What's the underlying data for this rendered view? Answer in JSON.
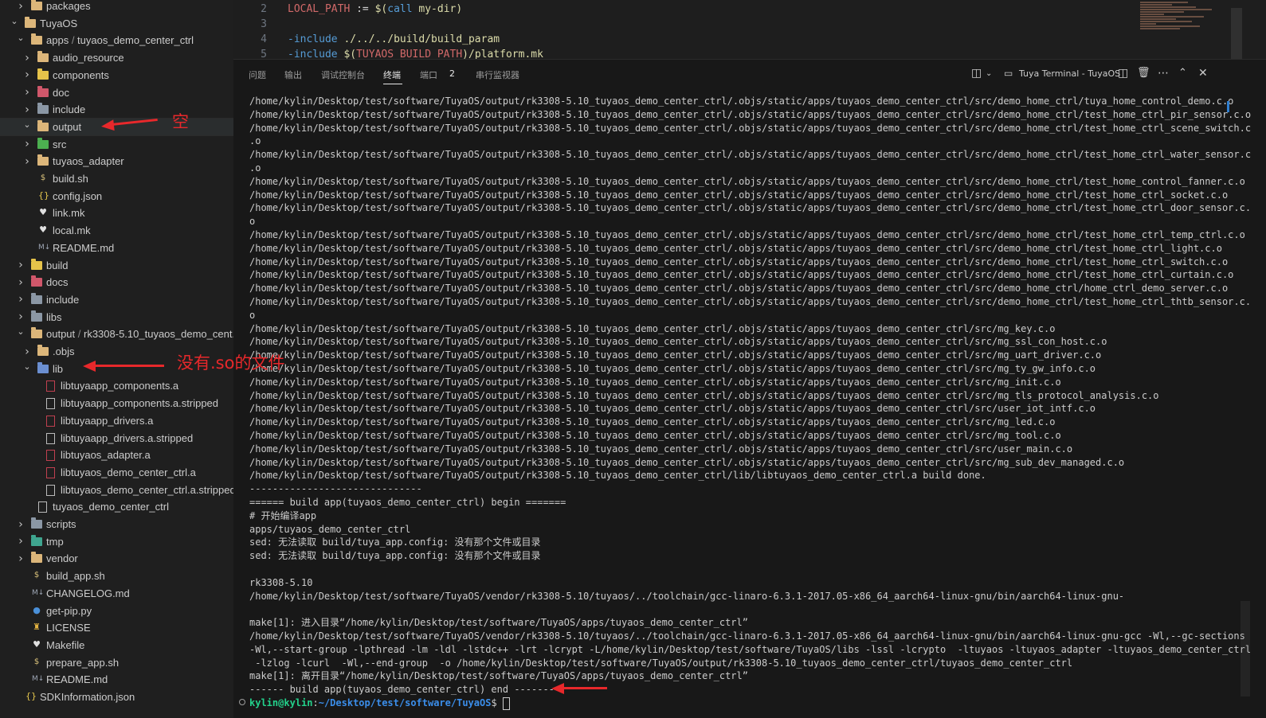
{
  "explorer": {
    "items": [
      {
        "label": "packages",
        "depth": 1,
        "expanded": false,
        "kind": "folder"
      },
      {
        "label": "TuyaOS",
        "depth": 0,
        "expanded": true,
        "kind": "folder"
      },
      {
        "label_a": "apps",
        "label_sep": " / ",
        "label_b": "tuyaos_demo_center_ctrl",
        "depth": 1,
        "expanded": true,
        "kind": "folder"
      },
      {
        "label": "audio_resource",
        "depth": 2,
        "expanded": false,
        "kind": "folder"
      },
      {
        "label": "components",
        "depth": 2,
        "expanded": false,
        "kind": "folder-build"
      },
      {
        "label": "doc",
        "depth": 2,
        "expanded": false,
        "kind": "folder-doc"
      },
      {
        "label": "include",
        "depth": 2,
        "expanded": false,
        "kind": "folder-grey"
      },
      {
        "label": "output",
        "depth": 2,
        "expanded": true,
        "kind": "folder",
        "selected": true
      },
      {
        "label": "src",
        "depth": 2,
        "expanded": false,
        "kind": "folder-src"
      },
      {
        "label": "tuyaos_adapter",
        "depth": 2,
        "expanded": false,
        "kind": "folder"
      },
      {
        "label": "build.sh",
        "depth": 2,
        "kind": "shell"
      },
      {
        "label": "config.json",
        "depth": 2,
        "kind": "json"
      },
      {
        "label": "link.mk",
        "depth": 2,
        "kind": "heart"
      },
      {
        "label": "local.mk",
        "depth": 2,
        "kind": "heart"
      },
      {
        "label": "README.md",
        "depth": 2,
        "kind": "md"
      },
      {
        "label": "build",
        "depth": 1,
        "expanded": false,
        "kind": "folder-build"
      },
      {
        "label": "docs",
        "depth": 1,
        "expanded": false,
        "kind": "folder-doc"
      },
      {
        "label": "include",
        "depth": 1,
        "expanded": false,
        "kind": "folder-grey"
      },
      {
        "label": "libs",
        "depth": 1,
        "expanded": false,
        "kind": "folder-grey"
      },
      {
        "label_a": "output",
        "label_sep": " / ",
        "label_b": "rk3308-5.10_tuyaos_demo_cent...",
        "depth": 1,
        "expanded": true,
        "kind": "folder"
      },
      {
        "label": ".objs",
        "depth": 2,
        "expanded": false,
        "kind": "folder"
      },
      {
        "label": "lib",
        "depth": 2,
        "expanded": true,
        "kind": "folder-blue"
      },
      {
        "label": "libtuyaapp_components.a",
        "depth": 3,
        "kind": "arch"
      },
      {
        "label": "libtuyaapp_components.a.stripped",
        "depth": 3,
        "kind": "doc"
      },
      {
        "label": "libtuyaapp_drivers.a",
        "depth": 3,
        "kind": "arch"
      },
      {
        "label": "libtuyaapp_drivers.a.stripped",
        "depth": 3,
        "kind": "doc"
      },
      {
        "label": "libtuyaos_adapter.a",
        "depth": 3,
        "kind": "arch"
      },
      {
        "label": "libtuyaos_demo_center_ctrl.a",
        "depth": 3,
        "kind": "arch"
      },
      {
        "label": "libtuyaos_demo_center_ctrl.a.stripped",
        "depth": 3,
        "kind": "doc"
      },
      {
        "label": "tuyaos_demo_center_ctrl",
        "depth": 2,
        "kind": "doc"
      },
      {
        "label": "scripts",
        "depth": 1,
        "expanded": false,
        "kind": "folder-grey"
      },
      {
        "label": "tmp",
        "depth": 1,
        "expanded": false,
        "kind": "folder-tmp"
      },
      {
        "label": "vendor",
        "depth": 1,
        "expanded": false,
        "kind": "folder"
      },
      {
        "label": "build_app.sh",
        "depth": 1,
        "kind": "shell"
      },
      {
        "label": "CHANGELOG.md",
        "depth": 1,
        "kind": "md"
      },
      {
        "label": "get-pip.py",
        "depth": 1,
        "kind": "py"
      },
      {
        "label": "LICENSE",
        "depth": 1,
        "kind": "lic"
      },
      {
        "label": "Makefile",
        "depth": 1,
        "kind": "heart"
      },
      {
        "label": "prepare_app.sh",
        "depth": 1,
        "kind": "shell"
      },
      {
        "label": "README.md",
        "depth": 1,
        "kind": "md"
      },
      {
        "label": "SDKInformation.json",
        "depth": 0,
        "kind": "json"
      }
    ]
  },
  "editor": {
    "lines": [
      {
        "num": "2",
        "parts": [
          {
            "t": "LOCAL_PATH",
            "c": "var"
          },
          {
            "t": " := ",
            "c": "op"
          },
          {
            "t": "$(",
            "c": "fn"
          },
          {
            "t": "call",
            "c": "kw"
          },
          {
            "t": " my-dir",
            "c": "fn"
          },
          {
            "t": ")",
            "c": "fn"
          }
        ]
      },
      {
        "num": "3",
        "parts": []
      },
      {
        "num": "4",
        "parts": [
          {
            "t": "-include",
            "c": "kw"
          },
          {
            "t": " ./../../build/build_param",
            "c": "fn"
          }
        ]
      },
      {
        "num": "5",
        "parts": [
          {
            "t": "-include",
            "c": "kw"
          },
          {
            "t": " $(",
            "c": "fn"
          },
          {
            "t": "TUYAOS_BUILD_PATH",
            "c": "var"
          },
          {
            "t": ")/platform.mk",
            "c": "fn"
          }
        ]
      }
    ]
  },
  "panel": {
    "tabs": [
      {
        "label": "问题",
        "active": false
      },
      {
        "label": "输出",
        "active": false
      },
      {
        "label": "调试控制台",
        "active": false
      },
      {
        "label": "终端",
        "active": true
      },
      {
        "label": "端口",
        "active": false,
        "badge": "2"
      },
      {
        "label": "串行监视器",
        "active": false
      }
    ],
    "terminal_name": "Tuya Terminal - TuyaOS"
  },
  "terminal": {
    "lines": [
      "/home/kylin/Desktop/test/software/TuyaOS/output/rk3308-5.10_tuyaos_demo_center_ctrl/.objs/static/apps/tuyaos_demo_center_ctrl/src/demo_home_ctrl/tuya_home_control_demo.c.o",
      "/home/kylin/Desktop/test/software/TuyaOS/output/rk3308-5.10_tuyaos_demo_center_ctrl/.objs/static/apps/tuyaos_demo_center_ctrl/src/demo_home_ctrl/test_home_ctrl_pir_sensor.c.o",
      "/home/kylin/Desktop/test/software/TuyaOS/output/rk3308-5.10_tuyaos_demo_center_ctrl/.objs/static/apps/tuyaos_demo_center_ctrl/src/demo_home_ctrl/test_home_ctrl_scene_switch.c",
      ".o",
      "/home/kylin/Desktop/test/software/TuyaOS/output/rk3308-5.10_tuyaos_demo_center_ctrl/.objs/static/apps/tuyaos_demo_center_ctrl/src/demo_home_ctrl/test_home_ctrl_water_sensor.c",
      ".o",
      "/home/kylin/Desktop/test/software/TuyaOS/output/rk3308-5.10_tuyaos_demo_center_ctrl/.objs/static/apps/tuyaos_demo_center_ctrl/src/demo_home_ctrl/test_home_control_fanner.c.o",
      "/home/kylin/Desktop/test/software/TuyaOS/output/rk3308-5.10_tuyaos_demo_center_ctrl/.objs/static/apps/tuyaos_demo_center_ctrl/src/demo_home_ctrl/test_home_ctrl_socket.c.o",
      "/home/kylin/Desktop/test/software/TuyaOS/output/rk3308-5.10_tuyaos_demo_center_ctrl/.objs/static/apps/tuyaos_demo_center_ctrl/src/demo_home_ctrl/test_home_ctrl_door_sensor.c.",
      "o",
      "/home/kylin/Desktop/test/software/TuyaOS/output/rk3308-5.10_tuyaos_demo_center_ctrl/.objs/static/apps/tuyaos_demo_center_ctrl/src/demo_home_ctrl/test_home_ctrl_temp_ctrl.c.o",
      "/home/kylin/Desktop/test/software/TuyaOS/output/rk3308-5.10_tuyaos_demo_center_ctrl/.objs/static/apps/tuyaos_demo_center_ctrl/src/demo_home_ctrl/test_home_ctrl_light.c.o",
      "/home/kylin/Desktop/test/software/TuyaOS/output/rk3308-5.10_tuyaos_demo_center_ctrl/.objs/static/apps/tuyaos_demo_center_ctrl/src/demo_home_ctrl/test_home_ctrl_switch.c.o",
      "/home/kylin/Desktop/test/software/TuyaOS/output/rk3308-5.10_tuyaos_demo_center_ctrl/.objs/static/apps/tuyaos_demo_center_ctrl/src/demo_home_ctrl/test_home_ctrl_curtain.c.o",
      "/home/kylin/Desktop/test/software/TuyaOS/output/rk3308-5.10_tuyaos_demo_center_ctrl/.objs/static/apps/tuyaos_demo_center_ctrl/src/demo_home_ctrl/home_ctrl_demo_server.c.o",
      "/home/kylin/Desktop/test/software/TuyaOS/output/rk3308-5.10_tuyaos_demo_center_ctrl/.objs/static/apps/tuyaos_demo_center_ctrl/src/demo_home_ctrl/test_home_ctrl_thtb_sensor.c.",
      "o",
      "/home/kylin/Desktop/test/software/TuyaOS/output/rk3308-5.10_tuyaos_demo_center_ctrl/.objs/static/apps/tuyaos_demo_center_ctrl/src/mg_key.c.o",
      "/home/kylin/Desktop/test/software/TuyaOS/output/rk3308-5.10_tuyaos_demo_center_ctrl/.objs/static/apps/tuyaos_demo_center_ctrl/src/mg_ssl_con_host.c.o",
      "/home/kylin/Desktop/test/software/TuyaOS/output/rk3308-5.10_tuyaos_demo_center_ctrl/.objs/static/apps/tuyaos_demo_center_ctrl/src/mg_uart_driver.c.o",
      "/home/kylin/Desktop/test/software/TuyaOS/output/rk3308-5.10_tuyaos_demo_center_ctrl/.objs/static/apps/tuyaos_demo_center_ctrl/src/mg_ty_gw_info.c.o",
      "/home/kylin/Desktop/test/software/TuyaOS/output/rk3308-5.10_tuyaos_demo_center_ctrl/.objs/static/apps/tuyaos_demo_center_ctrl/src/mg_init.c.o",
      "/home/kylin/Desktop/test/software/TuyaOS/output/rk3308-5.10_tuyaos_demo_center_ctrl/.objs/static/apps/tuyaos_demo_center_ctrl/src/mg_tls_protocol_analysis.c.o",
      "/home/kylin/Desktop/test/software/TuyaOS/output/rk3308-5.10_tuyaos_demo_center_ctrl/.objs/static/apps/tuyaos_demo_center_ctrl/src/user_iot_intf.c.o",
      "/home/kylin/Desktop/test/software/TuyaOS/output/rk3308-5.10_tuyaos_demo_center_ctrl/.objs/static/apps/tuyaos_demo_center_ctrl/src/mg_led.c.o",
      "/home/kylin/Desktop/test/software/TuyaOS/output/rk3308-5.10_tuyaos_demo_center_ctrl/.objs/static/apps/tuyaos_demo_center_ctrl/src/mg_tool.c.o",
      "/home/kylin/Desktop/test/software/TuyaOS/output/rk3308-5.10_tuyaos_demo_center_ctrl/.objs/static/apps/tuyaos_demo_center_ctrl/src/user_main.c.o",
      "/home/kylin/Desktop/test/software/TuyaOS/output/rk3308-5.10_tuyaos_demo_center_ctrl/.objs/static/apps/tuyaos_demo_center_ctrl/src/mg_sub_dev_managed.c.o",
      "/home/kylin/Desktop/test/software/TuyaOS/output/rk3308-5.10_tuyaos_demo_center_ctrl/lib/libtuyaos_demo_center_ctrl.a build done.",
      "------------------------------",
      "====== build app(tuyaos_demo_center_ctrl) begin =======",
      "# 开始编译app",
      "apps/tuyaos_demo_center_ctrl",
      "sed: 无法读取 build/tuya_app.config: 没有那个文件或目录",
      "sed: 无法读取 build/tuya_app.config: 没有那个文件或目录",
      "",
      "rk3308-5.10",
      "/home/kylin/Desktop/test/software/TuyaOS/vendor/rk3308-5.10/tuyaos/../toolchain/gcc-linaro-6.3.1-2017.05-x86_64_aarch64-linux-gnu/bin/aarch64-linux-gnu-",
      "",
      "make[1]: 进入目录“/home/kylin/Desktop/test/software/TuyaOS/apps/tuyaos_demo_center_ctrl”",
      "/home/kylin/Desktop/test/software/TuyaOS/vendor/rk3308-5.10/tuyaos/../toolchain/gcc-linaro-6.3.1-2017.05-x86_64_aarch64-linux-gnu/bin/aarch64-linux-gnu-gcc -Wl,--gc-sections",
      "-Wl,--start-group -lpthread -lm -ldl -lstdc++ -lrt -lcrypt -L/home/kylin/Desktop/test/software/TuyaOS/libs -lssl -lcrypto  -ltuyaos -ltuyaos_adapter -ltuyaos_demo_center_ctrl",
      " -lzlog -lcurl  -Wl,--end-group  -o /home/kylin/Desktop/test/software/TuyaOS/output/rk3308-5.10_tuyaos_demo_center_ctrl/tuyaos_demo_center_ctrl",
      "make[1]: 离开目录“/home/kylin/Desktop/test/software/TuyaOS/apps/tuyaos_demo_center_ctrl”",
      "------ build app(tuyaos_demo_center_ctrl) end --------"
    ],
    "prompt_user": "kylin@kylin",
    "prompt_sep": ":",
    "prompt_path": "~/Desktop/test/software/TuyaOS",
    "prompt_end": "$ "
  },
  "annotations": {
    "empty_note": "空",
    "no_so_note": "没有.so的文件"
  },
  "colors": {
    "annotation": "#e8282b",
    "prompt_user": "#23d18b",
    "prompt_path": "#3b8eea"
  }
}
